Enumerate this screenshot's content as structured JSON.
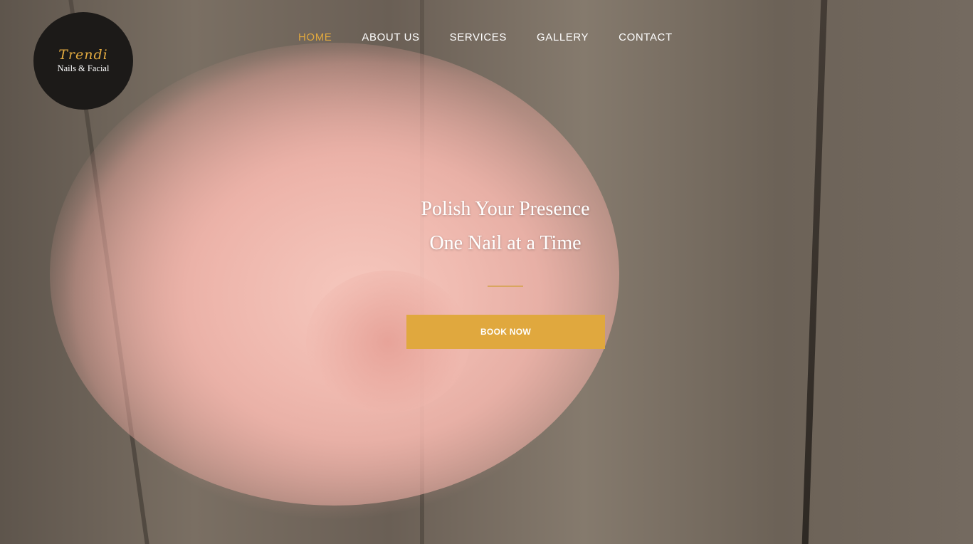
{
  "brand": {
    "script": "Trendi",
    "subtitle": "Nails & Facial"
  },
  "nav": {
    "items": [
      {
        "label": "HOME",
        "active": true
      },
      {
        "label": "ABOUT US",
        "active": false
      },
      {
        "label": "SERVICES",
        "active": false
      },
      {
        "label": "GALLERY",
        "active": false
      },
      {
        "label": "CONTACT",
        "active": false
      }
    ]
  },
  "hero": {
    "line1": "Polish Your Presence",
    "line2": "One Nail at a Time",
    "button_label": "BOOK NOW"
  },
  "colors": {
    "accent": "#e0a83e",
    "logo_bg": "#1c1a18",
    "text": "#ffffff"
  }
}
